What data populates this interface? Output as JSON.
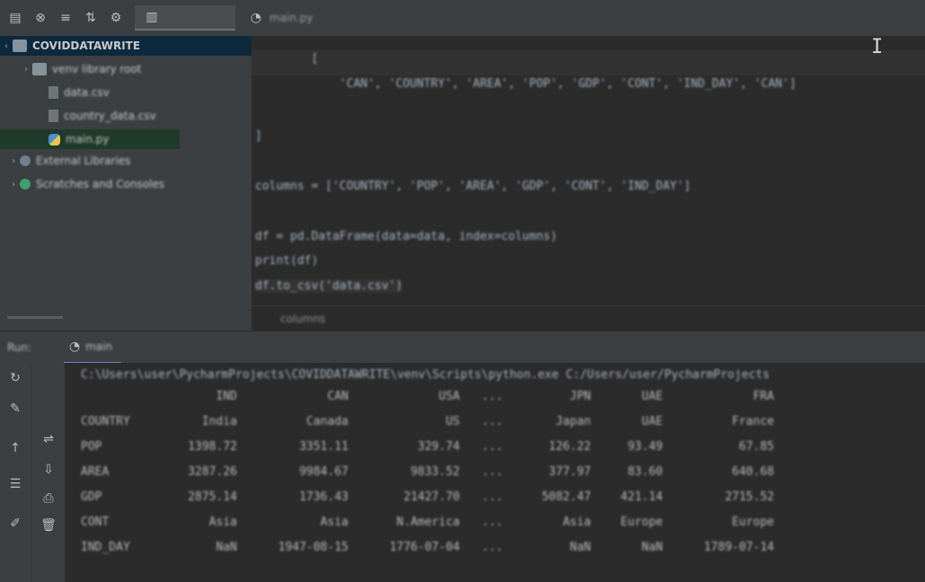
{
  "toolbar": {
    "icons": [
      "project-icon",
      "close-circle-icon",
      "collapse-icon",
      "expand-icon",
      "gear-icon"
    ],
    "tab_active_label": "",
    "tab2_label": "main.py"
  },
  "tree": {
    "root_label": "COVIDDATAWRITE",
    "items": [
      {
        "label": "venv  library root"
      },
      {
        "label": "data.csv"
      },
      {
        "label": "country_data.csv"
      },
      {
        "label": "main.py"
      },
      {
        "label": "External Libraries"
      },
      {
        "label": "Scratches and Consoles"
      }
    ]
  },
  "editor": {
    "lines": [
      "        ",
      "        [                                                                   ",
      "            'CAN', 'COUNTRY', 'AREA', 'POP', 'GDP', 'CONT', 'IND_DAY', 'CAN']",
      "]",
      "columns = ['COUNTRY', 'POP', 'AREA', 'GDP', 'CONT', 'IND_DAY']",
      "df = pd.DataFrame(data=data, index=columns)",
      "print(df)",
      "df.to_csv('data.csv')"
    ]
  },
  "breadcrumbs": [
    "",
    "columns"
  ],
  "run_panel": {
    "left_label": "Run:",
    "tab_label": "main"
  },
  "console": {
    "command": "C:\\Users\\user\\PycharmProjects\\COVIDDATAWRITE\\venv\\Scripts\\python.exe C:/Users/user/PycharmProjects",
    "header": [
      "",
      "IND",
      "CAN",
      "USA",
      "...",
      "JPN",
      "UAE",
      "FRA"
    ],
    "rows": [
      [
        "COUNTRY",
        "India",
        "Canada",
        "US",
        "...",
        "Japan",
        "UAE",
        "France"
      ],
      [
        "POP",
        "1398.72",
        "3351.11",
        "329.74",
        "...",
        "126.22",
        "93.49",
        "67.85"
      ],
      [
        "AREA",
        "3287.26",
        "9984.67",
        "9833.52",
        "...",
        "377.97",
        "83.60",
        "640.68"
      ],
      [
        "GDP",
        "2875.14",
        "1736.43",
        "21427.70",
        "...",
        "5082.47",
        "421.14",
        "2715.52"
      ],
      [
        "CONT",
        "Asia",
        "Asia",
        "N.America",
        "...",
        "Asia",
        "Europe",
        "Europe"
      ],
      [
        "IND_DAY",
        "NaN",
        "1947-08-15",
        "1776-07-04",
        "...",
        "NaN",
        "NaN",
        "1789-07-14"
      ]
    ]
  }
}
